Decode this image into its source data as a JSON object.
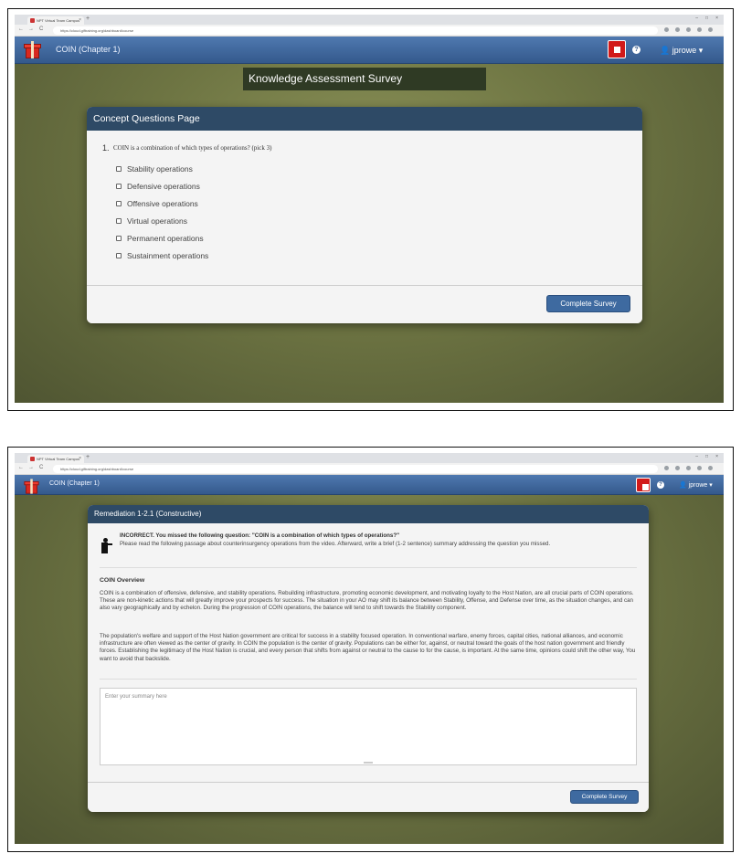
{
  "browser": {
    "tab_title": "NPT Virtual Team Campus",
    "tab_close": "×",
    "new_tab": "+",
    "url": "https://cloud.giftraining.org/dashboard/course",
    "win_min": "–",
    "win_max": "□",
    "win_close": "×",
    "nav_back": "←",
    "nav_forward": "→",
    "nav_reload": "C"
  },
  "navbar": {
    "course_title": "COIN (Chapter 1)",
    "help_glyph": "?",
    "user_name": "jprowe",
    "user_prefix": "👤",
    "caret": "▾"
  },
  "survey": {
    "header": "Knowledge Assessment Survey",
    "page_title": "Concept Questions Page",
    "question_number": "1.",
    "question_text": "COIN is a combination of which types of operations? (pick 3)",
    "options": [
      "Stability operations",
      "Defensive operations",
      "Offensive operations",
      "Virtual operations",
      "Permanent operations",
      "Sustainment operations"
    ],
    "complete_button": "Complete Survey"
  },
  "remediation": {
    "title": "Remediation 1-2.1 (Constructive)",
    "incorrect_heading": "INCORRECT. You missed the following question: \"COIN is a combination of which types of operations?\"",
    "instructions": "Please read the following passage about counterinsurgency operations from the video. Afterward, write a brief (1-2 sentence) summary addressing the question you missed.",
    "section_title": "COIN Overview",
    "paragraph_1": "COIN is a combination of offensive, defensive, and stability operations. Rebuilding infrastructure, promoting economic development, and motivating loyalty to the Host Nation, are all crucial parts of COIN operations. These are non-kinetic actions that will greatly improve your prospects for success. The situation in your AO may shift its balance between Stability, Offense, and Defense over time, as the situation changes, and can also vary geographically and by echelon. During the progression of COIN operations, the balance will tend to shift towards the Stability component.",
    "paragraph_2": "The population's welfare and support of the Host Nation government are critical for success in a stability focused operation. In conventional warfare, enemy forces, capital cities, national alliances, and economic infrastructure are often viewed as the center of gravity. In COIN the population is the center of gravity. Populations can be either for, against, or neutral toward the goals of the host nation government and friendly forces. Establishing the legitimacy of the Host Nation is crucial, and every person that shifts from against or neutral to the cause to for the cause, is important. At the same time, opinions could shift the other way, You want to avoid that backslide.",
    "summary_placeholder": "Enter your summary here",
    "complete_button": "Complete Survey"
  },
  "colors": {
    "navbar": "#3f6aa0",
    "panel_header": "#2e4a66",
    "stop_button": "#d21a1a",
    "button": "#3e6aa0",
    "background": "#6e7543"
  }
}
